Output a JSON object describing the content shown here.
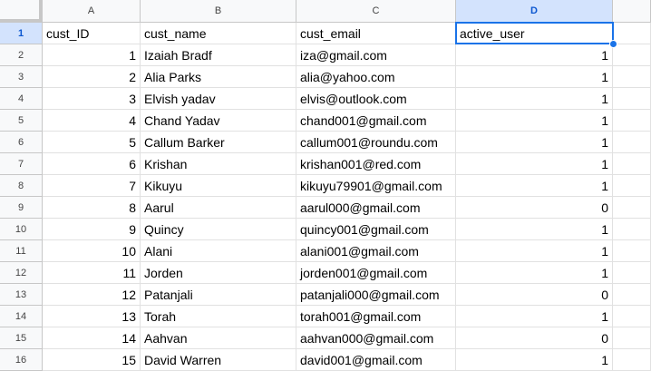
{
  "columns": [
    "A",
    "B",
    "C",
    "D"
  ],
  "selected_column": "D",
  "selected_row": 1,
  "rows": [
    [
      "cust_ID",
      "cust_name",
      "cust_email",
      "active_user"
    ],
    [
      "1",
      "Izaiah Bradf",
      "iza@gmail.com",
      "1"
    ],
    [
      "2",
      "Alia Parks",
      "alia@yahoo.com",
      "1"
    ],
    [
      "3",
      "Elvish yadav",
      "elvis@outlook.com",
      "1"
    ],
    [
      "4",
      "Chand Yadav",
      "chand001@gmail.com",
      "1"
    ],
    [
      "5",
      "Callum Barker",
      "callum001@roundu.com",
      "1"
    ],
    [
      "6",
      "Krishan",
      "krishan001@red.com",
      "1"
    ],
    [
      "7",
      "Kikuyu",
      "kikuyu79901@gmail.com",
      "1"
    ],
    [
      "8",
      "Aarul",
      "aarul000@gmail.com",
      "0"
    ],
    [
      "9",
      "Quincy",
      "quincy001@gmail.com",
      "1"
    ],
    [
      "10",
      "Alani",
      "alani001@gmail.com",
      "1"
    ],
    [
      "11",
      "Jorden",
      "jorden001@gmail.com",
      "1"
    ],
    [
      "12",
      "Patanjali",
      "patanjali000@gmail.com",
      "0"
    ],
    [
      "13",
      "Torah",
      "torah001@gmail.com",
      "1"
    ],
    [
      "14",
      "Aahvan",
      "aahvan000@gmail.com",
      "0"
    ],
    [
      "15",
      "David Warren",
      "david001@gmail.com",
      "1"
    ]
  ]
}
